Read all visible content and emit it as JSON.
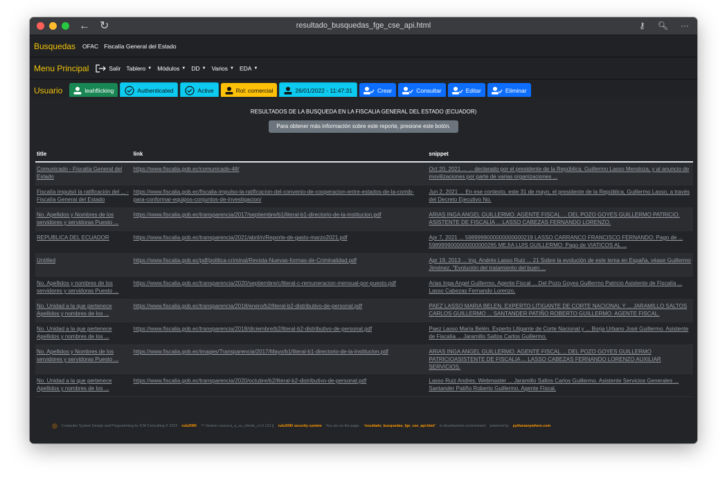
{
  "window": {
    "title": "resultado_busquedas_fge_cse_api.html"
  },
  "top_nav": {
    "brand": "Busquedas",
    "links": [
      "OFAC",
      "Fiscalía General del Estado"
    ]
  },
  "menu": {
    "brand": "Menu Principal",
    "salir": "Salir",
    "dropdowns": [
      "Tablero",
      "Módulos",
      "DD",
      "Varios",
      "EDA"
    ]
  },
  "user_bar": {
    "brand": "Usuario",
    "username": "leahflicking",
    "authenticated": "Authenticated",
    "active": "Active",
    "rol": "Rol: comercial",
    "datetime": "26/01/2022 - 11:47:31",
    "crear": "Crear",
    "consultar": "Consultar",
    "editar": "Editar",
    "eliminar": "Eliminar"
  },
  "main": {
    "heading": "RESULTADOS DE LA BUSQUEDA EN LA FISCALIA GENERAL DEL ESTADO (ECUADOR)",
    "info_button": "Para obtener más información sobre este reporte, presione este botón."
  },
  "table": {
    "headers": [
      "title",
      "link",
      "snippet"
    ],
    "rows": [
      {
        "title": "Comunicado - Fiscalía General del Estado",
        "link": "https://www.fiscalia.gob.ec/comunicado-48/",
        "snippet": "Oct 20, 2021 ... ... declarado por el presidente de la República, Guillermo Lasso Mendoza, y al anuncio de movilizaciones por parte de varias organizaciones ..."
      },
      {
        "title": "Fiscalía impulsó la ratificación del ... - Fiscalía General del Estado",
        "link": "https://www.fiscalia.gob.ec/fiscalia-impulso-la-ratificacion-del-convenio-de-cooperacion-entre-estados-de-la-comib-para-conformar-equipos-conjuntos-de-investigacion/",
        "snippet": "Jun 2, 2021 ... En ese contexto, este 31 de mayo, el presidente de la República, Guillermo Lasso, a través del Decreto Ejecutivo No."
      },
      {
        "title": "No. Apellidos y Nombres de los servidores y servidoras Puesto ...",
        "link": "https://www.fiscalia.gob.ec/transparencia/2017/septiembre/b1/literal-b1-directorio-de-la-institucion.pdf",
        "snippet": "ARIAS INGA ANGEL GUILLERMO. AGENTE FISCAL ... DEL POZO GOYES GUILLERMO PATRICIO. ASISTENTE DE FISCALÍA ... LASSO CABEZAS FERNANDO LORENZO."
      },
      {
        "title": "REPUBLICA DEL ECUADOR",
        "link": "https://www.fiscalia.gob.ec/transparencia/2021/abril/n/Reporte-de-gasto-marzo2021.pdf",
        "snippet": "Apr 7, 2021 ... 5989999000000000000219 LASSO CARRANCO FRANCISCO FERNANDO: Pago de ... 5989999000000000000265 MEJIA LUIS GUILLERMO: Pago de VIATICOS AL ..."
      },
      {
        "title": "Untitled",
        "link": "https://www.fiscalia.gob.ec/pdf/politica-criminal/Revista-Nuevas-formas-de-Criminalidad.pdf",
        "snippet": "Apr 19, 2013 ... Ing. Andrés Lasso Ruiz ... 21 Sobre la evolución de este tema en España, véase Guillermo Jiménez, \"Evolución del tratamiento del buen ..."
      },
      {
        "title": "No. Apellidos y nombres de los servidores y servidoras Puesto ...",
        "link": "https://www.fiscalia.gob.ec/transparencia/2020/septiembre/c/literal-c-remuneracion-mensual-por-puesto.pdf",
        "snippet": "Arias Inga Angel Guillermo, Agente Fiscal ... Del Pozo Goyes Guillermo Patricio Asistente de Fiscalía ... Lasso Cabezas Fernando Lorenzo."
      },
      {
        "title": "No. Unidad a la que pertenece Apellidos y nombres de los ...",
        "link": "https://www.fiscalia.gob.ec/transparencia/2018/enero/b2/literal-b2-distributivo-de-personal.pdf",
        "snippet": "PAEZ LASSO MARIA BELEN. EXPERTO LITIGANTE DE CORTE NACIONAL Y ... JARAMILLO SALTOS CARLOS GUILLERMO ... SANTANDER PATIÑO ROBERTO GUILLERMO. AGENTE FISCAL."
      },
      {
        "title": "No. Unidad a la que pertenece Apellidos y nombres de los ...",
        "link": "https://www.fiscalia.gob.ec/transparencia/2018/diciembre/b2/literal-b2-distributivo-de-personal.pdf",
        "snippet": "Paez Lasso María Belén. Experto Litigante de Corte Nacional y ... Borja Urbano José Guillermo. Asistente de Fiscalía ... Jaramillo Saltos Carlos Guillermo."
      },
      {
        "title": "No. Apellidos y Nombres de los servidores y servidoras Puesto ...",
        "link": "https://www.fiscalia.gob.ec/images/Transparencia/2017/Mayo/b1/literal-b1-directorio-de-la-institucion.pdf",
        "snippet": "ARIAS INGA ANGEL GUILLERMO. AGENTE FISCAL ... DEL POZO GOYES GUILLERMO PATRICIOASISTENTE DE FISCALIA ... LASSO CABEZAS FERNANDO LORENZO AUXILIAR SERVICIOS."
      },
      {
        "title": "No. Unidad a la que pertenece Apellidos y nombres de los ...",
        "link": "https://www.fiscalia.gob.ec/transparencia/2020/octubre/b2/literal-b2-distributivo-de-personal.pdf",
        "snippet": "Lasso Ruiz Andres. Webmaster ... Jaramillo Saltos Carlos Guillermo. Asistente Servicios Generales ... Santander Patiño Roberto Guillermo. Agente Fiscal."
      }
    ]
  },
  "footer": {
    "text1": "Computer System Design and Programming by ICM Consulting © 2022",
    "rule": "rule2090",
    "text2": "™ Version conozca_a_su_cliente_v1.0.123 ||",
    "security": "rule2090 security system",
    "text3": "You are on the page:",
    "page": "'resultado_busquedas_fge_cse_api.html'",
    "text4": "in development environment",
    "powered": "powered by",
    "host": "pythonanywhere.com"
  }
}
